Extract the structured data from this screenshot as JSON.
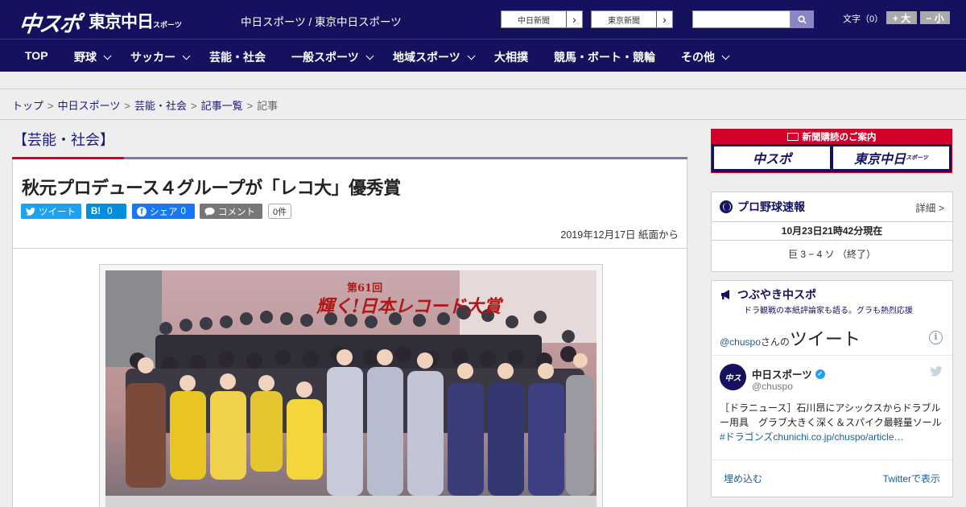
{
  "header": {
    "logo_main": "中スポ",
    "logo_tokyo": "東京中日",
    "logo_tokyo_small": "スポーツ",
    "site_name": "中日スポーツ / 東京中日スポーツ",
    "ext_links": [
      "中日新聞",
      "東京新聞"
    ],
    "search_placeholder": "",
    "font_size_label": "文字（0）",
    "font_bigger": "+ 大",
    "font_smaller": "− 小"
  },
  "nav": [
    {
      "label": "TOP"
    },
    {
      "label": "野球"
    },
    {
      "label": "サッカー"
    },
    {
      "label": "芸能・社会"
    },
    {
      "label": "一般スポーツ"
    },
    {
      "label": "地域スポーツ"
    },
    {
      "label": "大相撲"
    },
    {
      "label": "競馬・ボート・競輪"
    },
    {
      "label": "その他"
    }
  ],
  "breadcrumb": [
    "トップ",
    "中日スポーツ",
    "芸能・社会",
    "記事一覧",
    "記事"
  ],
  "breadcrumb_sep": ">",
  "article": {
    "category": "【芸能・社会】",
    "title": "秋元プロデュース４グループが「レコ大」優秀賞",
    "share": {
      "tweet": "ツイート",
      "hatena": "B!",
      "hatena_count": "0",
      "facebook": "シェア",
      "facebook_count": "0",
      "comment": "コメント",
      "comment_count": "0件"
    },
    "dateline": "2019年12月17日 紙面から",
    "photo_banner_top": "第61回",
    "photo_banner": "輝く!日本レコード大賞"
  },
  "sidebar": {
    "subscribe": {
      "title": "新聞購読のご案内",
      "left": "中スポ",
      "right": "東京中日",
      "right_small": "スポーツ"
    },
    "baseball": {
      "title": "プロ野球速報",
      "detail": "詳細 >",
      "time": "10月23日21時42分現在",
      "score": "巨 3 − 4 ソ （終了）"
    },
    "tweets": {
      "title": "つぶやき中スポ",
      "subtitle": "ドラ観戦の本紙評論家も語る。グラも熱烈応援",
      "handle_prefix": "@chuspo",
      "handle_suffix": "さんの",
      "heading": "ツイート",
      "account_name": "中日スポーツ",
      "account_handle": "@chuspo",
      "avatar_text": "中ス",
      "tweet_text": "［ドラニュース］石川昂にアシックスからドラブルー用具　グラブ大きく深く＆スパイク最軽量ソール",
      "tweet_link": "#ドラゴンズchunichi.co.jp/chuspo/article…",
      "embed": "埋め込む",
      "view_on_twitter": "Twitterで表示"
    }
  },
  "colors": {
    "navy": "#14125f",
    "red": "#d2002b",
    "twitter": "#1da1f2",
    "hatena": "#008fde",
    "facebook": "#1877f2",
    "comment": "#777777"
  }
}
